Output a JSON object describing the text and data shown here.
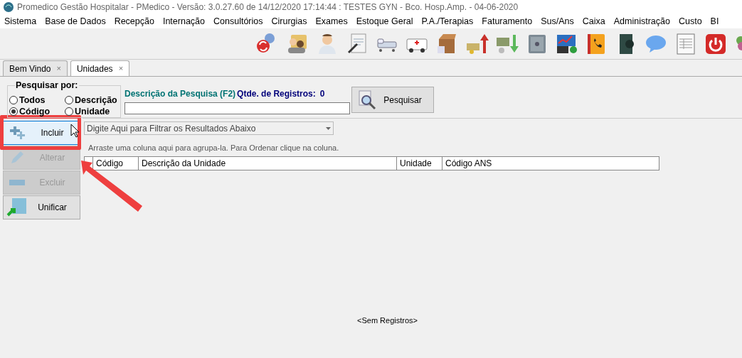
{
  "window": {
    "title": "Promedico Gestão Hospitalar - PMedico - Versão: 3.0.27.60 de 14/12/2020 17:14:44 : TESTES GYN - Bco. Hosp.Amp. - 04-06-2020"
  },
  "menu": [
    "Sistema",
    "Base de Dados",
    "Recepção",
    "Internação",
    "Consultórios",
    "Cirurgias",
    "Exames",
    "Estoque Geral",
    "P.A./Terapias",
    "Faturamento",
    "Sus/Ans",
    "Caixa",
    "Administração",
    "Custo",
    "BI"
  ],
  "tabs": [
    {
      "label": "Bem Vindo",
      "close": "×",
      "selected": false
    },
    {
      "label": "Unidades",
      "close": "×",
      "selected": true
    }
  ],
  "search": {
    "group_label": "Pesquisar por:",
    "options": [
      {
        "label": "Todos",
        "selected": false
      },
      {
        "label": "Descrição",
        "selected": false
      },
      {
        "label": "Código",
        "selected": true
      },
      {
        "label": "Unidade",
        "selected": false
      }
    ],
    "description_label": "Descrição da Pesquisa (F2)",
    "count_label": "Qtde. de Registros:",
    "count": "0",
    "button": "Pesquisar"
  },
  "actions": [
    {
      "label": "Incluir",
      "disabled": false,
      "focused": true
    },
    {
      "label": "Alterar",
      "disabled": true,
      "focused": false
    },
    {
      "label": "Excluir",
      "disabled": true,
      "focused": false
    },
    {
      "label": "Unificar",
      "disabled": false,
      "focused": false
    }
  ],
  "grid": {
    "filter_placeholder": "Digite Aqui para Filtrar os Resultados Abaixo",
    "group_hint": "Arraste uma coluna aqui para agrupa-la. Para Ordenar clique na coluna.",
    "columns": [
      "Código",
      "Descrição da Unidade",
      "Unidade",
      "Código ANS"
    ],
    "empty_text": "<Sem Registros>"
  }
}
